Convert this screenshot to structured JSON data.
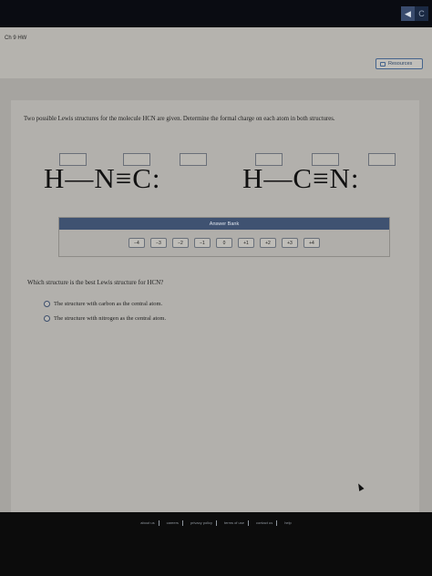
{
  "window": {
    "back_glyph": "◀",
    "forward_glyph": "C"
  },
  "header": {
    "assignment_title": "Ch 9 HW",
    "resources_label": "Resources"
  },
  "question": {
    "prompt": "Two possible Lewis structures for the molecule HCN are given. Determine the formal charge on each atom in both structures.",
    "structure_1": "H—N≡C:",
    "structure_2": "H—C≡N:"
  },
  "answer_bank": {
    "title": "Answer Bank",
    "chips": [
      "−4",
      "−3",
      "−2",
      "−1",
      "0",
      "+1",
      "+2",
      "+3",
      "+4"
    ]
  },
  "question2": {
    "prompt": "Which structure is the best Lewis structure for HCN?",
    "options": [
      "The structure with carbon as the central atom.",
      "The structure with nitrogen as the central atom."
    ]
  },
  "footer": {
    "links": [
      "about us",
      "careers",
      "privacy policy",
      "terms of use",
      "contact us",
      "help"
    ]
  }
}
